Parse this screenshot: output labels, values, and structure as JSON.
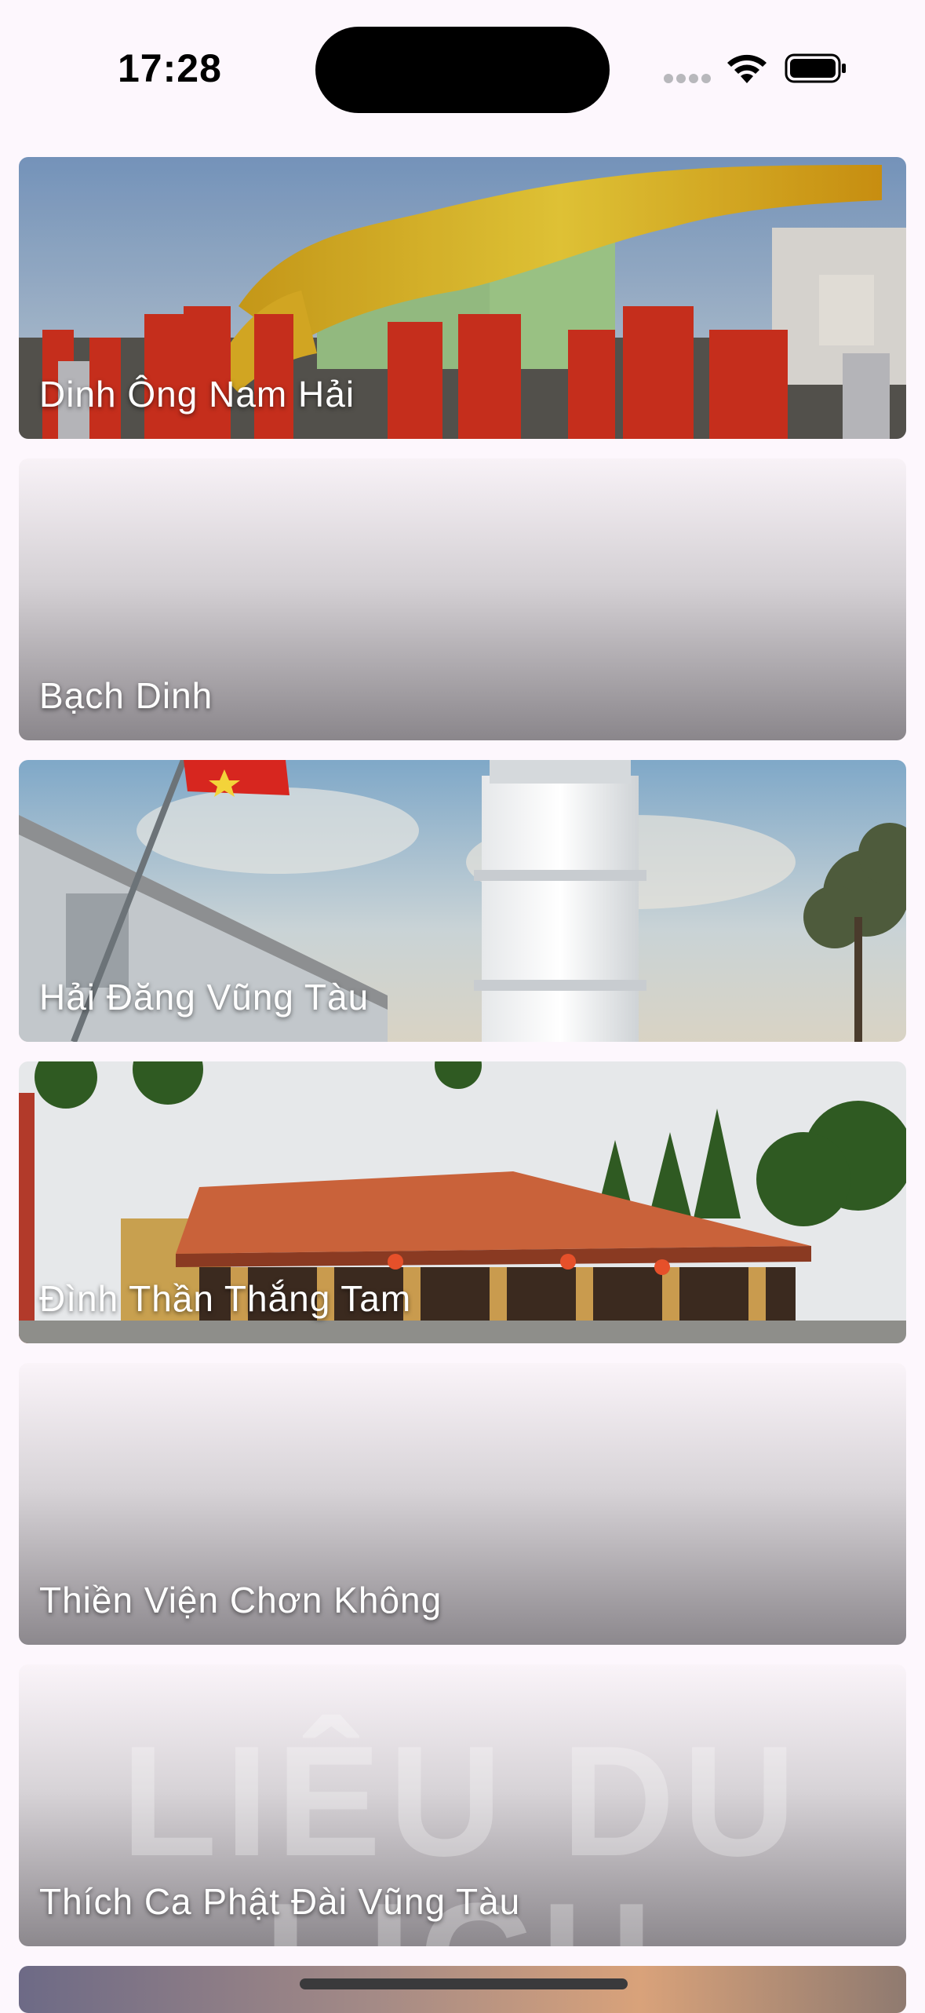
{
  "status_bar": {
    "time": "17:28",
    "icons": [
      "signal-dots-icon",
      "wifi-icon",
      "battery-icon"
    ]
  },
  "places": [
    {
      "title": "Dinh Ông Nam Hải",
      "image": "dragon-dance-festival"
    },
    {
      "title": "Bạch Dinh",
      "image": "placeholder-gradient"
    },
    {
      "title": "Hải Đăng Vũng Tàu",
      "image": "lighthouse-with-flag"
    },
    {
      "title": "Đình Thần Thắng Tam",
      "image": "temple-red-roof"
    },
    {
      "title": "Thiền Viện Chơn Không",
      "image": "placeholder-gradient"
    },
    {
      "title": "Thích Ca Phật Đài Vũng Tàu",
      "image": "placeholder-gradient-watermark",
      "watermark": "LIÊU DU LỊCH"
    },
    {
      "title": "",
      "image": "sunset-partial"
    }
  ],
  "colors": {
    "background": "#fdf7fd",
    "title_text": "#ffffff",
    "placeholder_top": "#f7f1f6",
    "placeholder_bottom": "#8a868b"
  }
}
